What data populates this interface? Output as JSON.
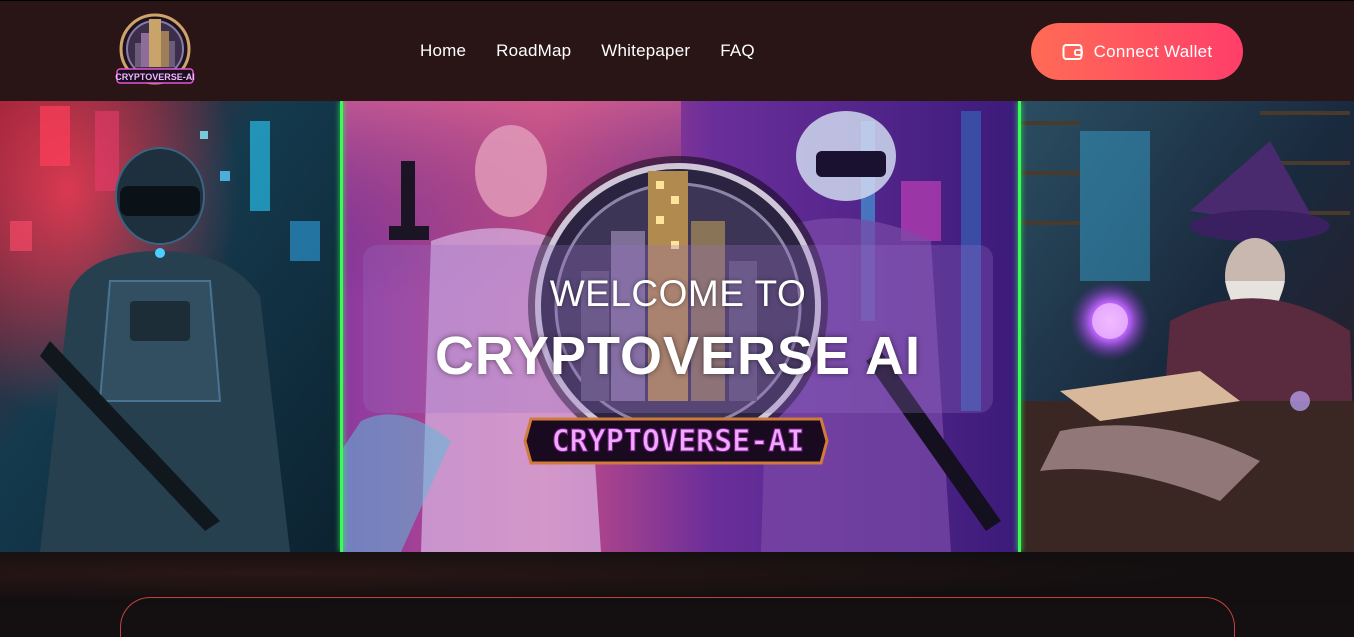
{
  "nav": {
    "logo_text": "CRYPTOVERSE-AI",
    "links": [
      "Home",
      "RoadMap",
      "Whitepaper",
      "FAQ"
    ],
    "connect_label": "Connect Wallet",
    "connect_icon": "wallet-icon"
  },
  "hero": {
    "welcome_line": "WELCOME TO",
    "title": "CRYPTOVERSE AI",
    "emblem_text": "CRYPTOVERSE-AI"
  },
  "colors": {
    "nav_bg": "#2a1516",
    "accent_start": "#ff6b55",
    "accent_end": "#ff3e6a",
    "divider": "#35ff55",
    "page_bg": "#140f10"
  }
}
